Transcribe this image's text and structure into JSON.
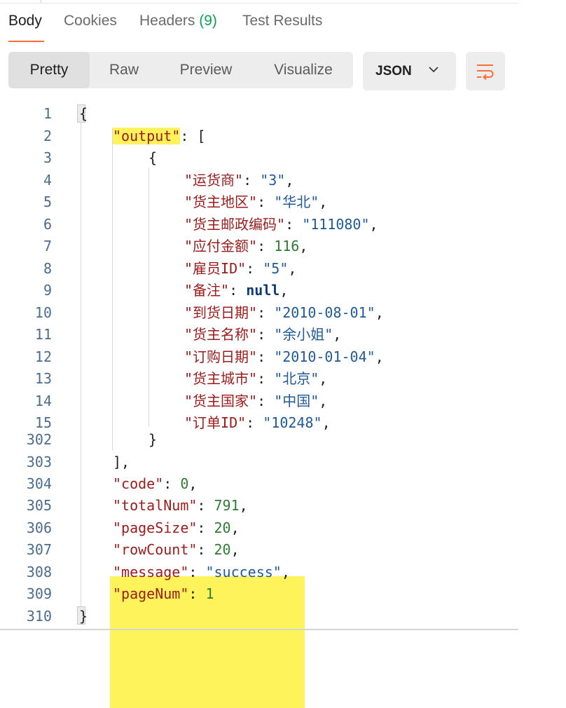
{
  "tabs": [
    {
      "label": "Body",
      "active": true
    },
    {
      "label": "Cookies"
    },
    {
      "label": "Headers",
      "count": "(9)"
    },
    {
      "label": "Test Results"
    }
  ],
  "view_modes": [
    "Pretty",
    "Raw",
    "Preview",
    "Visualize"
  ],
  "active_view_mode": "Pretty",
  "format": "JSON",
  "wrap_icon": "wrap-lines-icon",
  "chevron_icon": "chevron-down-icon",
  "colors": {
    "accent": "#ff6c37",
    "highlight": "#fff35c",
    "key": "#9c1b1b",
    "string": "#1f5a99",
    "number": "#2f7d32"
  },
  "code": {
    "line_numbers": [
      "1",
      "2",
      "3",
      "4",
      "5",
      "6",
      "7",
      "8",
      "9",
      "10",
      "11",
      "12",
      "13",
      "14",
      "15",
      "302",
      "303",
      "304",
      "305",
      "306",
      "307",
      "308",
      "309",
      "310"
    ],
    "open_brace": "{",
    "output_key": "\"output\"",
    "output_open": ": [",
    "item_open": "{",
    "item_fields": [
      {
        "key": "\"运货商\"",
        "value": "\"3\"",
        "type": "string",
        "end": ","
      },
      {
        "key": "\"货主地区\"",
        "value": "\"华北\"",
        "type": "string",
        "end": ","
      },
      {
        "key": "\"货主邮政编码\"",
        "value": "\"111080\"",
        "type": "string",
        "end": ","
      },
      {
        "key": "\"应付金额\"",
        "value": "116",
        "type": "number",
        "end": ","
      },
      {
        "key": "\"雇员ID\"",
        "value": "\"5\"",
        "type": "string",
        "end": ","
      },
      {
        "key": "\"备注\"",
        "value": "null",
        "type": "keyword",
        "end": ","
      },
      {
        "key": "\"到货日期\"",
        "value": "\"2010-08-01\"",
        "type": "string",
        "end": ","
      },
      {
        "key": "\"货主名称\"",
        "value": "\"余小姐\"",
        "type": "string",
        "end": ","
      },
      {
        "key": "\"订购日期\"",
        "value": "\"2010-01-04\"",
        "type": "string",
        "end": ","
      },
      {
        "key": "\"货主城市\"",
        "value": "\"北京\"",
        "type": "string",
        "end": ","
      },
      {
        "key": "\"货主国家\"",
        "value": "\"中国\"",
        "type": "string",
        "end": ","
      },
      {
        "key": "\"订单ID\"",
        "value": "\"10248\"",
        "type": "string",
        "end": ","
      }
    ],
    "item_close": "}",
    "array_close": "],",
    "meta_fields": [
      {
        "key": "\"code\"",
        "value": "0",
        "end": ","
      },
      {
        "key": "\"totalNum\"",
        "value": "791",
        "end": ","
      },
      {
        "key": "\"pageSize\"",
        "value": "20",
        "end": ","
      },
      {
        "key": "\"rowCount\"",
        "value": "20",
        "end": ","
      },
      {
        "key": "\"message\"",
        "value": "\"success\"",
        "end": ","
      },
      {
        "key": "\"pageNum\"",
        "value": "1",
        "end": ""
      }
    ],
    "close_brace": "}"
  }
}
